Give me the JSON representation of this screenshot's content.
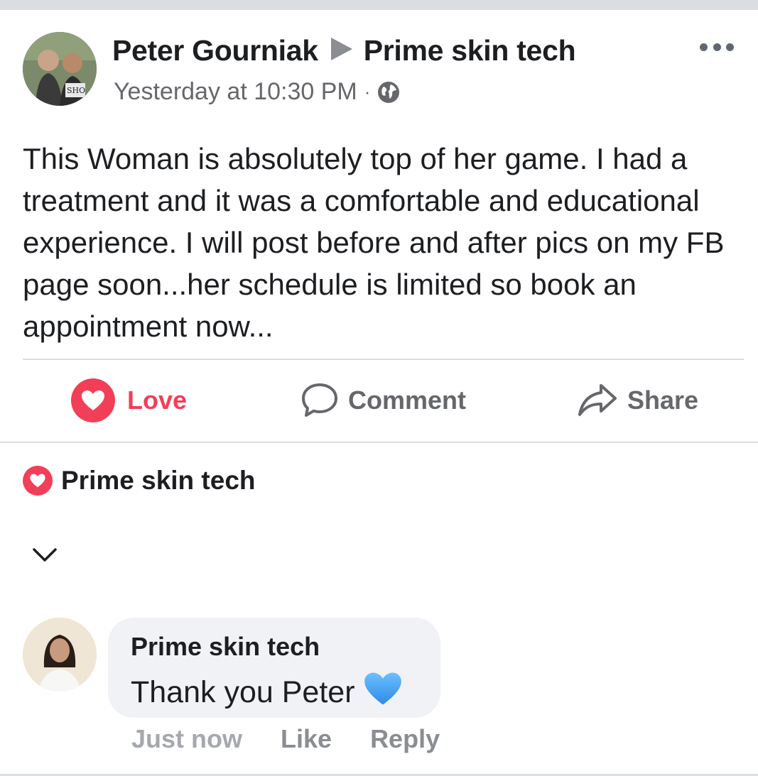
{
  "post": {
    "author": "Peter Gourniak",
    "target_page": "Prime skin tech",
    "timestamp": "Yesterday at 10:30 PM",
    "separator": "·",
    "privacy_icon": "globe-icon",
    "body": "This Woman is absolutely top of her game. I had a treatment and it was a comfortable and educational experience. I will post before and after pics on my FB page soon...her schedule is limited so book an appointment now...",
    "more_icon": "more-horizontal-icon"
  },
  "actions": {
    "love_label": "Love",
    "comment_label": "Comment",
    "share_label": "Share"
  },
  "reactions": {
    "reactor_name": "Prime skin tech",
    "icon": "heart-icon"
  },
  "comment": {
    "author": "Prime skin tech",
    "text": "Thank you Peter",
    "emoji": "blue-heart-icon",
    "timestamp": "Just now",
    "like_label": "Like",
    "reply_label": "Reply"
  },
  "colors": {
    "love_red": "#f33e58",
    "secondary_text": "#65676b",
    "bubble_bg": "#f0f2f5",
    "divider": "#dadde1",
    "blue_heart": "#4ba4f0"
  }
}
